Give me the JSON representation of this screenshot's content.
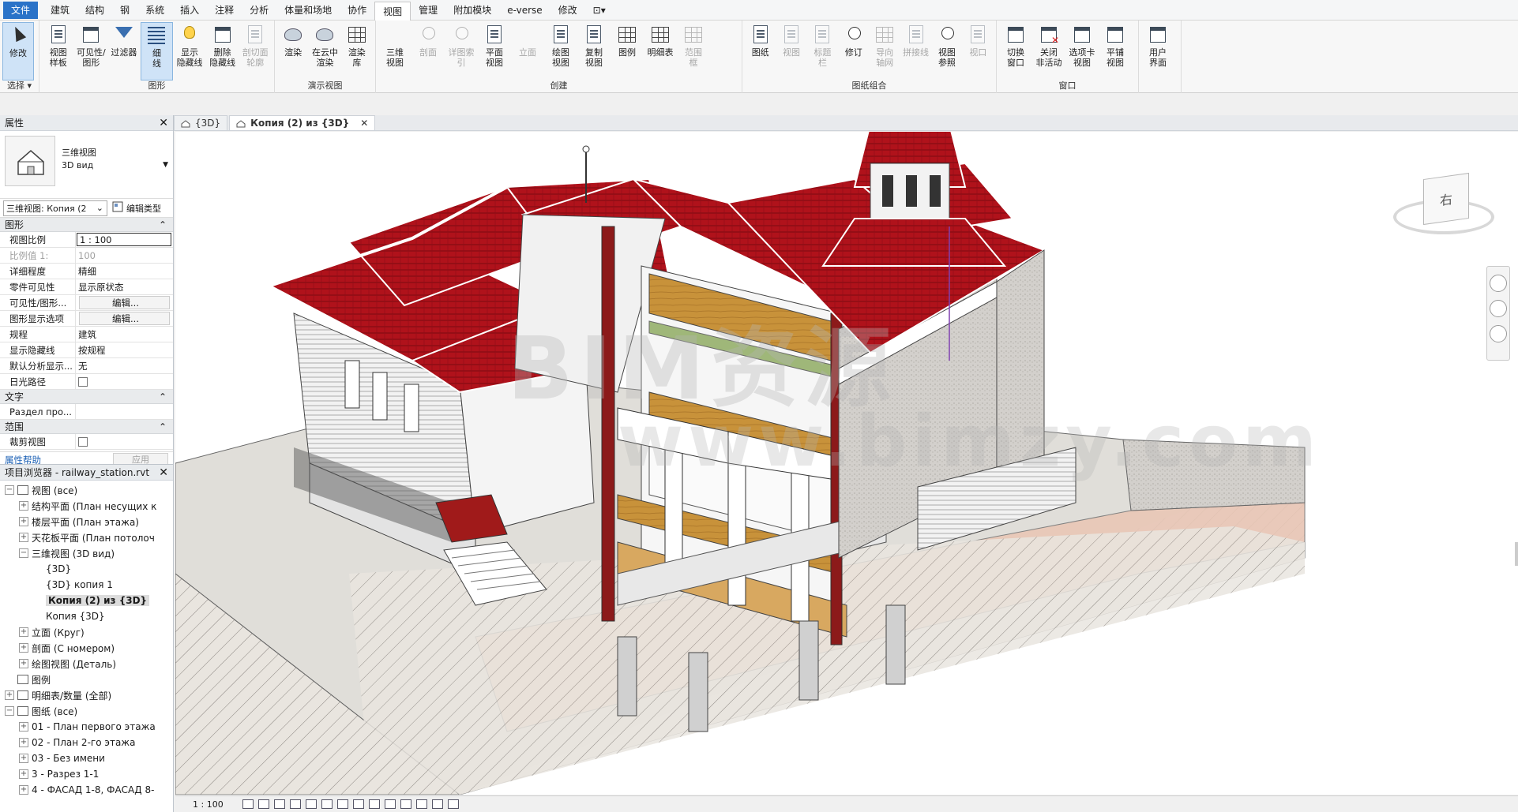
{
  "menubar": {
    "tabs": [
      "文件",
      "建筑",
      "结构",
      "钢",
      "系统",
      "插入",
      "注释",
      "分析",
      "体量和场地",
      "协作",
      "视图",
      "管理",
      "附加模块",
      "e-verse",
      "修改"
    ],
    "active_tab": "视图"
  },
  "ribbon": {
    "select_panel": {
      "modify": "修改",
      "title": "选择 ▾"
    },
    "graphics_panel": {
      "title": "图形",
      "buttons": [
        "视图\n样板",
        "可见性/\n图形",
        "过滤器",
        "细\n线",
        "显示\n隐藏线",
        "删除\n隐藏线",
        "剖切面\n轮廓"
      ]
    },
    "presentation_panel": {
      "title": "演示视图",
      "buttons": [
        "渲染",
        "在云中\n渲染",
        "渲染\n库"
      ]
    },
    "create_panel": {
      "title": "创建",
      "buttons": [
        "三维\n视图",
        "剖面",
        "详图索引",
        "平面\n视图",
        "立面",
        "绘图\n视图",
        "复制\n视图",
        "图例",
        "明细表",
        "范围\n框"
      ]
    },
    "sheet_panel": {
      "title": "图纸组合",
      "buttons": [
        "图纸",
        "视图",
        "标题\n栏",
        "修订",
        "导向\n轴网",
        "拼接线",
        "视图\n参照",
        "视口"
      ]
    },
    "windows_panel": {
      "title": "窗口",
      "buttons": [
        "切换\n窗口",
        "关闭\n非活动",
        "选项卡\n视图",
        "平铺\n视图"
      ]
    },
    "ui_panel": {
      "buttons": [
        "用户\n界面"
      ]
    }
  },
  "view_tabs": [
    {
      "label": "{3D}",
      "active": false
    },
    {
      "label": "Копия (2) из {3D}",
      "active": true
    }
  ],
  "properties": {
    "header": "属性",
    "type_name": "三维视图",
    "type_sub": "3D вид",
    "instance_selector": "三维视图: Копия (2",
    "edit_type": "编辑类型",
    "groups": {
      "graphics": "图形",
      "text": "文字",
      "extents": "范围"
    },
    "rows": {
      "view_scale": {
        "k": "视图比例",
        "v": "1 : 100"
      },
      "scale_value": {
        "k": "比例值 1:",
        "v": "100"
      },
      "detail_level": {
        "k": "详细程度",
        "v": "精细"
      },
      "parts_visibility": {
        "k": "零件可见性",
        "v": "显示原状态"
      },
      "vg_overrides": {
        "k": "可见性/图形...",
        "v": "编辑..."
      },
      "graphic_display": {
        "k": "图形显示选项",
        "v": "编辑..."
      },
      "discipline": {
        "k": "规程",
        "v": "建筑"
      },
      "show_hidden": {
        "k": "显示隐藏线",
        "v": "按规程"
      },
      "analysis_display": {
        "k": "默认分析显示...",
        "v": "无"
      },
      "sun_path": {
        "k": "日光路径",
        "v": ""
      },
      "section_prop": {
        "k": "Раздел про...",
        "v": ""
      },
      "crop_view": {
        "k": "裁剪视图",
        "v": ""
      }
    },
    "help_link": "属性帮助",
    "apply": "应用"
  },
  "browser": {
    "header": "项目浏览器 - railway_station.rvt",
    "nodes": [
      {
        "level": 0,
        "tw": "−",
        "label": "视图 (все)",
        "icon": true
      },
      {
        "level": 1,
        "tw": "+",
        "label": "结构平面 (План несущих к"
      },
      {
        "level": 1,
        "tw": "+",
        "label": "楼层平面 (План этажа)"
      },
      {
        "level": 1,
        "tw": "+",
        "label": "天花板平面 (План потолоч"
      },
      {
        "level": 1,
        "tw": "−",
        "label": "三维视图 (3D вид)"
      },
      {
        "level": 2,
        "tw": "",
        "label": "{3D}"
      },
      {
        "level": 2,
        "tw": "",
        "label": "{3D} копия 1"
      },
      {
        "level": 2,
        "tw": "",
        "label": "Копия (2) из {3D}",
        "selected": true
      },
      {
        "level": 2,
        "tw": "",
        "label": "Копия {3D}"
      },
      {
        "level": 1,
        "tw": "+",
        "label": "立面 (Круг)"
      },
      {
        "level": 1,
        "tw": "+",
        "label": "剖面 (С номером)"
      },
      {
        "level": 1,
        "tw": "+",
        "label": "绘图视图 (Деталь)"
      },
      {
        "level": 0,
        "tw": "",
        "label": "图例",
        "icon": true
      },
      {
        "level": 0,
        "tw": "+",
        "label": "明细表/数量 (全部)",
        "icon": true
      },
      {
        "level": 0,
        "tw": "−",
        "label": "图纸 (все)",
        "icon": true
      },
      {
        "level": 1,
        "tw": "+",
        "label": "01 - План первого этажа"
      },
      {
        "level": 1,
        "tw": "+",
        "label": "02 - План 2-го этажа"
      },
      {
        "level": 1,
        "tw": "+",
        "label": "03 - Без имени"
      },
      {
        "level": 1,
        "tw": "+",
        "label": "3 - Разрез 1-1"
      },
      {
        "level": 1,
        "tw": "+",
        "label": "4 - ФАСАД 1-8, ФАСАД 8-"
      }
    ]
  },
  "viewport": {
    "viewcube_face": "右",
    "watermark_line1": "BIM资源",
    "watermark_line2": "www.bimzy.com"
  },
  "statusbar": {
    "scale": "1 : 100"
  },
  "colors": {
    "roof_red": "#b0121b",
    "floor_wood": "#c8923a",
    "accent_blue": "#2a73c8"
  }
}
